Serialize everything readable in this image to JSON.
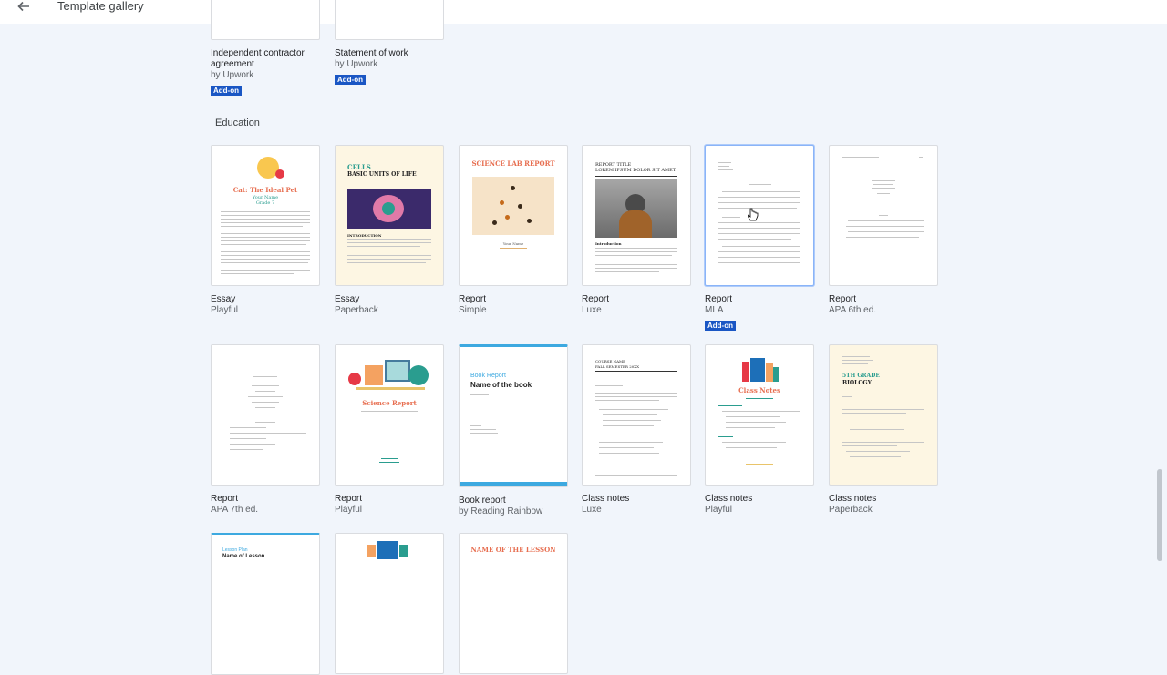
{
  "header": {
    "title": "Template gallery",
    "back_icon": "arrow-back-icon"
  },
  "section": {
    "education": "Education"
  },
  "top_cards": [
    {
      "name": "Independent contractor agreement",
      "author": "by Upwork",
      "badge": "Add-on"
    },
    {
      "name": "Statement of work",
      "author": "by Upwork",
      "badge": "Add-on"
    }
  ],
  "row1": [
    {
      "name": "Essay",
      "variant": "Playful",
      "thumb_title": "Cat: The Ideal Pet",
      "thumb_sub": "Your Name\nGrade 7"
    },
    {
      "name": "Essay",
      "variant": "Paperback",
      "thumb_title": "CELLS",
      "thumb_sub": "BASIC UNITS OF LIFE",
      "thumb_h": "INTRODUCTION"
    },
    {
      "name": "Report",
      "variant": "Simple",
      "thumb_title": "SCIENCE LAB REPORT",
      "thumb_sub": "Your Name"
    },
    {
      "name": "Report",
      "variant": "Luxe",
      "thumb_title": "REPORT TITLE",
      "thumb_sub": "LOREM IPSUM DOLOR SIT AMET",
      "thumb_h": "Introduction"
    },
    {
      "name": "Report",
      "variant": "MLA",
      "badge": "Add-on"
    },
    {
      "name": "Report",
      "variant": "APA 6th ed."
    }
  ],
  "row2": [
    {
      "name": "Report",
      "variant": "APA 7th ed."
    },
    {
      "name": "Report",
      "variant": "Playful",
      "thumb_title": "Science Report"
    },
    {
      "name": "Book report",
      "variant": "by Reading Rainbow",
      "thumb_title": "Book Report",
      "thumb_sub": "Name of the book"
    },
    {
      "name": "Class notes",
      "variant": "Luxe",
      "thumb_title": "COURSE NAME",
      "thumb_sub": "FALL SEMESTER 20XX"
    },
    {
      "name": "Class notes",
      "variant": "Playful",
      "thumb_title": "Class Notes"
    },
    {
      "name": "Class notes",
      "variant": "Paperback",
      "thumb_title": "5TH GRADE",
      "thumb_sub": "BIOLOGY"
    }
  ],
  "row3": [
    {
      "thumb_title": "Lesson Plan",
      "thumb_sub": "Name of Lesson"
    },
    {},
    {
      "thumb_title": "NAME OF THE LESSON"
    }
  ],
  "colors": {
    "accent": "#1a56c4",
    "background": "#f1f5fb",
    "selected_border": "#8ab4f8"
  }
}
